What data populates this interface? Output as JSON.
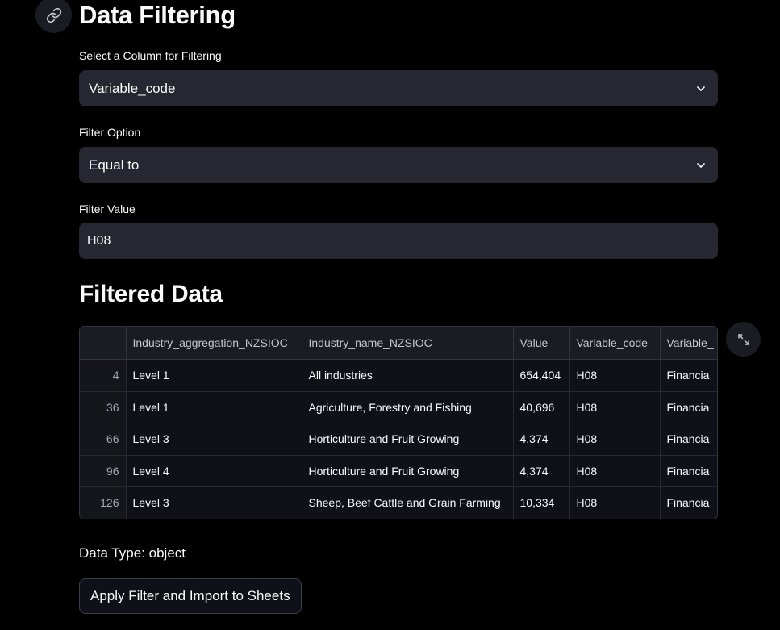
{
  "header": {
    "title": "Data Filtering",
    "anchor_icon": "link-icon"
  },
  "column_select": {
    "label": "Select a Column for Filtering",
    "value": "Variable_code",
    "icon": "chevron-down-icon"
  },
  "filter_option": {
    "label": "Filter Option",
    "value": "Equal to",
    "icon": "chevron-down-icon"
  },
  "filter_value": {
    "label": "Filter Value",
    "value": "H08"
  },
  "filtered": {
    "title": "Filtered Data",
    "expand_icon": "fullscreen-icon",
    "columns": [
      "",
      "Industry_aggregation_NZSIOC",
      "Industry_name_NZSIOC",
      "Value",
      "Variable_code",
      "Variable_"
    ],
    "rows": [
      [
        "4",
        "Level 1",
        "All industries",
        "654,404",
        "H08",
        "Financia"
      ],
      [
        "36",
        "Level 1",
        "Agriculture, Forestry and Fishing",
        "40,696",
        "H08",
        "Financia"
      ],
      [
        "66",
        "Level 3",
        "Horticulture and Fruit Growing",
        "4,374",
        "H08",
        "Financia"
      ],
      [
        "96",
        "Level 4",
        "Horticulture and Fruit Growing",
        "4,374",
        "H08",
        "Financia"
      ],
      [
        "126",
        "Level 3",
        "Sheep, Beef Cattle and Grain Farming",
        "10,334",
        "H08",
        "Financia"
      ]
    ]
  },
  "data_type": "Data Type: object",
  "action": {
    "label": "Apply Filter and Import to Sheets"
  }
}
